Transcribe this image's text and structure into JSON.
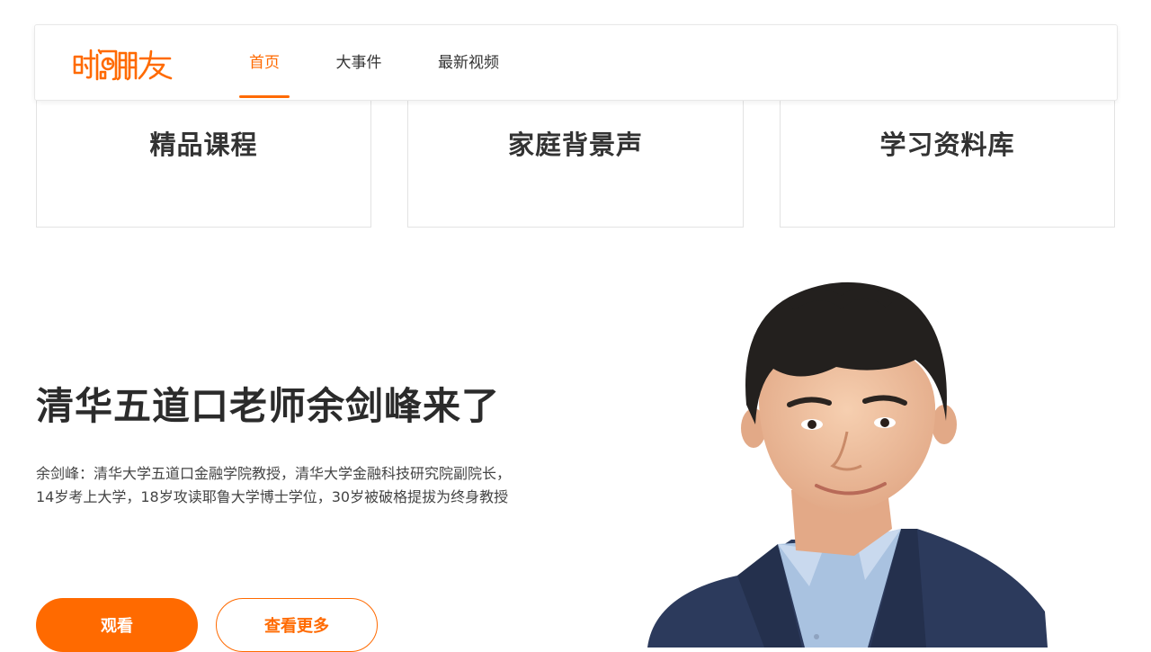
{
  "brand": {
    "logo_text": "时间的朋友",
    "accent_color": "#ff6a00"
  },
  "nav": {
    "items": [
      {
        "label": "首页",
        "active": true
      },
      {
        "label": "大事件",
        "active": false
      },
      {
        "label": "最新视频",
        "active": false
      }
    ]
  },
  "categories": [
    {
      "label": "精品课程"
    },
    {
      "label": "家庭背景声"
    },
    {
      "label": "学习资料库"
    }
  ],
  "hero": {
    "title": "清华五道口老师余剑峰来了",
    "description": "余剑峰：清华大学五道口金融学院教授，清华大学金融科技研究院副院长，14岁考上大学，18岁攻读耶鲁大学博士学位，30岁被破格提拔为终身教授",
    "watch_label": "观看",
    "more_label": "查看更多",
    "image": "presenter-portrait"
  }
}
